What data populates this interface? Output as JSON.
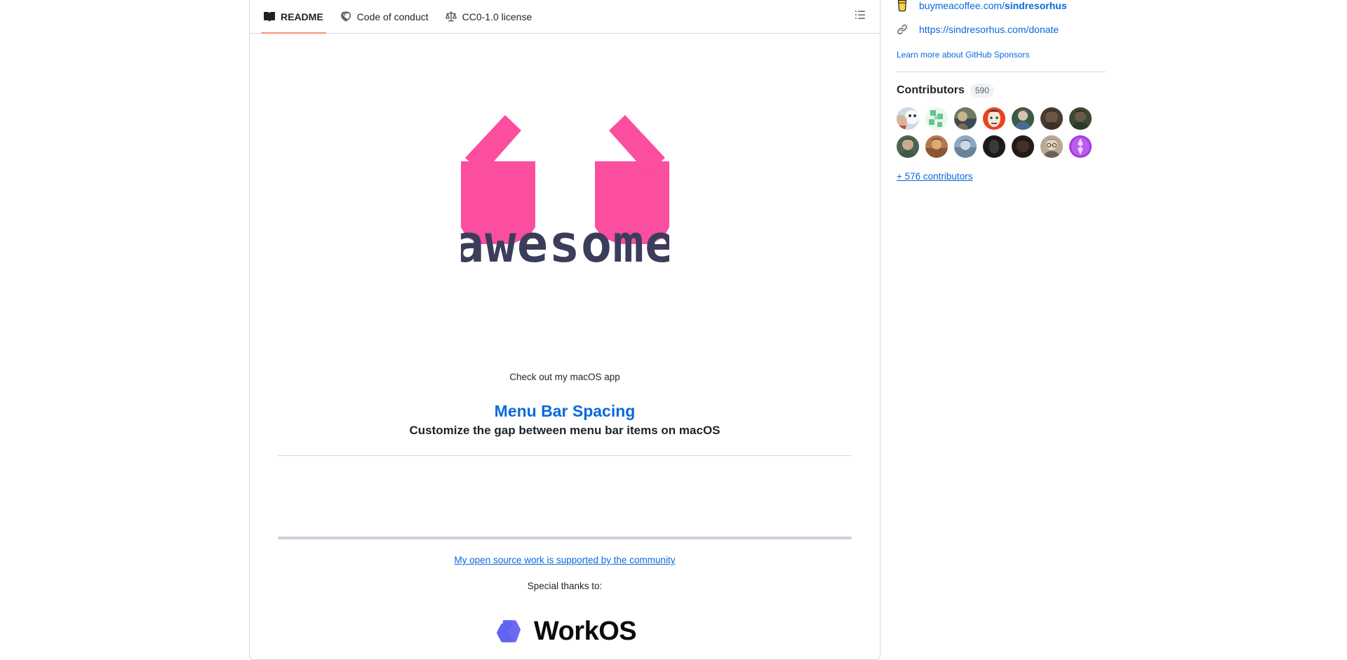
{
  "readme_panel": {
    "tabs": [
      {
        "label": "README",
        "icon": "book-icon",
        "active": true
      },
      {
        "label": "Code of conduct",
        "icon": "code-of-conduct-icon",
        "active": false
      },
      {
        "label": "CC0-1.0 license",
        "icon": "law-icon",
        "active": false
      }
    ],
    "outline_button": {
      "icon": "list-unordered-icon",
      "title": "Outline"
    },
    "logo": {
      "alt": "awesome",
      "wordmark": "awesome",
      "glasses_color": "#FB4E9F",
      "wordmark_color": "#3B3D5B"
    },
    "promo": {
      "kicker": "Check out my macOS app",
      "title": "Menu Bar Spacing",
      "subtitle": "Customize the gap between menu bar items on macOS",
      "title_color": "#0969da"
    },
    "support": {
      "link_text": "My open source work is supported by the community",
      "thanks_text": "Special thanks to:",
      "sponsor_name": "WorkOS",
      "sponsor_mark_color": "#6363F1"
    }
  },
  "sidebar": {
    "funding": [
      {
        "icon": "beverage-icon",
        "text_prefix": "buymeacoffee.com/",
        "text_bold": "sindresorhus"
      },
      {
        "icon": "link-icon",
        "text_prefix": "https://sindresorhus.com/donate",
        "text_bold": ""
      }
    ],
    "funding_links": {
      "coffee": "buymeacoffee.com/sindresorhus",
      "donate": "https://sindresorhus.com/donate"
    },
    "learn_more": "Learn more about GitHub Sponsors",
    "contributors": {
      "title": "Contributors",
      "count": "590",
      "more_link": "+ 576 contributors",
      "avatars": [
        {
          "name": "contributor-1",
          "bg": "#cfd8e3",
          "fg": "#f2f4f7",
          "accent": "#c94f3d"
        },
        {
          "name": "contributor-2",
          "bg": "#eaf6ee",
          "fg": "#63c68a",
          "accent": "#63c68a"
        },
        {
          "name": "contributor-3",
          "bg": "#6d7a62",
          "fg": "#3f4a58",
          "accent": "#c8b48a"
        },
        {
          "name": "contributor-4",
          "bg": "#e8431e",
          "fg": "#f7e7d8",
          "accent": "#2a2a2a"
        },
        {
          "name": "contributor-5",
          "bg": "#3a5a46",
          "fg": "#d6c3ae",
          "accent": "#4a6b92"
        },
        {
          "name": "contributor-6",
          "bg": "#4a3b33",
          "fg": "#6d5647",
          "accent": "#2b211c"
        },
        {
          "name": "contributor-7",
          "bg": "#3c4a33",
          "fg": "#6b5a4a",
          "accent": "#241c16"
        },
        {
          "name": "contributor-8",
          "bg": "#4a6552",
          "fg": "#c9a98f",
          "accent": "#2f4034"
        },
        {
          "name": "contributor-9",
          "bg": "#b5794f",
          "fg": "#e0a878",
          "accent": "#6a4028"
        },
        {
          "name": "contributor-10",
          "bg": "#8fa8bf",
          "fg": "#cbd9e4",
          "accent": "#4e6579"
        },
        {
          "name": "contributor-11",
          "bg": "#1b1b1b",
          "fg": "#3a3a3a",
          "accent": "#0d0d0d"
        },
        {
          "name": "contributor-12",
          "bg": "#241a16",
          "fg": "#43302a",
          "accent": "#130d0b"
        },
        {
          "name": "contributor-13",
          "bg": "#b9a894",
          "fg": "#e2d6c6",
          "accent": "#5a4a3c"
        },
        {
          "name": "contributor-14",
          "bg": "#a23ce0",
          "fg": "#e3a6ff",
          "accent": "#6c13a8"
        }
      ]
    }
  }
}
